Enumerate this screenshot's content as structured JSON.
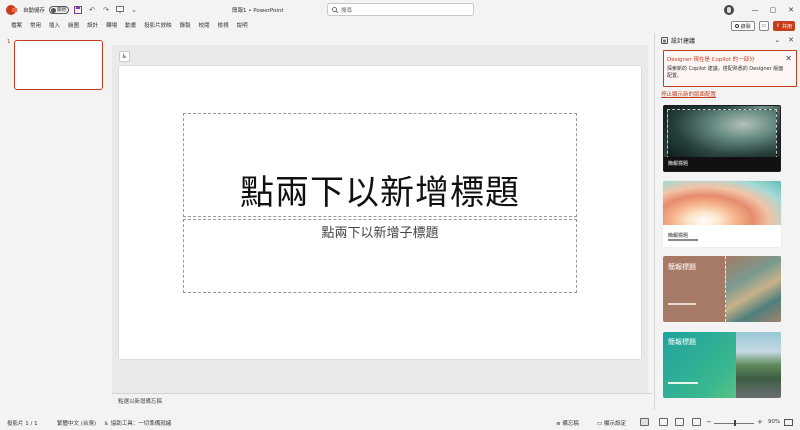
{
  "titlebar": {
    "autosave_label": "自動儲存",
    "autosave_state": "關閉",
    "doc_title": "簡報1 • PowerPoint",
    "search_placeholder": "搜尋",
    "qat_icons": [
      "save-icon",
      "undo-icon",
      "redo-icon",
      "present-icon",
      "customize-icon"
    ],
    "window_icons": [
      "minimize-icon",
      "restore-icon",
      "close-icon"
    ]
  },
  "ribbon": {
    "tabs": [
      "檔案",
      "常用",
      "插入",
      "繪圖",
      "設計",
      "轉場",
      "動畫",
      "投影片放映",
      "錄製",
      "校閱",
      "檢視",
      "說明"
    ],
    "record_label": "錄製",
    "share_label": "共用"
  },
  "thumbnails": {
    "slide_number": "1"
  },
  "slide": {
    "title_placeholder": "點兩下以新增標題",
    "subtitle_placeholder": "點兩下以新增子標題"
  },
  "notes": {
    "placeholder": "點選以新增備忘稿"
  },
  "designer": {
    "title": "設計建議",
    "notice_title": "Designer 現在是 Copilot 的一部分",
    "notice_body": "探索新的 Copilot 建議，搭配熟悉的 Designer 版面配置。",
    "stop_link": "停止顯示新的版面配置",
    "designs": [
      {
        "label": "簡報標題"
      },
      {
        "label": "簡報標題"
      },
      {
        "label": "簡報標題"
      },
      {
        "label": "簡報標題"
      }
    ]
  },
  "status": {
    "slide_info": "投影片 1 / 1",
    "language": "繁體中文 (台灣)",
    "accessibility": "協助工具：一切準備就緒",
    "notes_btn": "備忘稿",
    "display_btn": "顯示設定",
    "zoom": "90%"
  },
  "colors": {
    "accent": "#c43e1c",
    "background": "#f3f3f3"
  }
}
